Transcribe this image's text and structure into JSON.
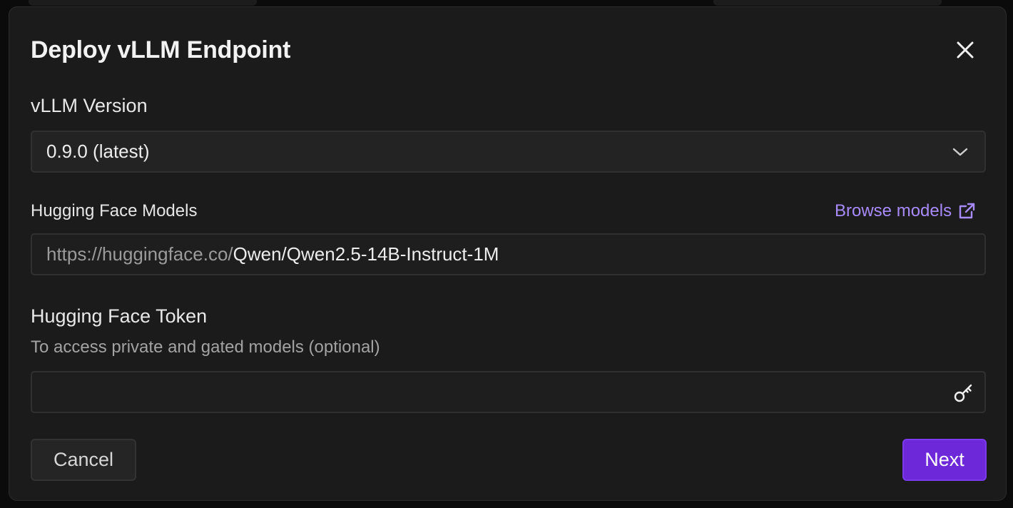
{
  "dialog": {
    "title": "Deploy vLLM Endpoint",
    "close_icon": "close-icon"
  },
  "version": {
    "label": "vLLM Version",
    "selected": "0.9.0 (latest)",
    "chevron_icon": "chevron-down-icon"
  },
  "models": {
    "label": "Hugging Face Models",
    "browse_label": "Browse models",
    "browse_icon": "external-link-icon",
    "url_prefix": "https://huggingface.co/",
    "value": "Qwen/Qwen2.5-14B-Instruct-1M"
  },
  "token": {
    "label": "Hugging Face Token",
    "help": "To access private and gated models (optional)",
    "value": "",
    "icon": "key-icon"
  },
  "actions": {
    "cancel_label": "Cancel",
    "next_label": "Next"
  },
  "colors": {
    "accent": "#6d28d9",
    "link": "#a78bfa",
    "surface": "#1b1b1b"
  }
}
